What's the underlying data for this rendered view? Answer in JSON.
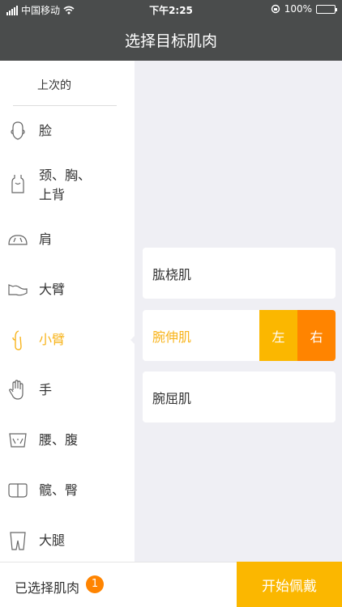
{
  "status_bar": {
    "carrier": "中国移动",
    "time": "下午2:25",
    "battery": "100%",
    "battery_level": 1.0
  },
  "header": {
    "title": "选择目标肌肉"
  },
  "sidebar": {
    "recent_label": "上次的",
    "items": [
      {
        "label": "脸",
        "icon": "face-icon"
      },
      {
        "label": "颈、胸、\n上背",
        "icon": "torso-icon"
      },
      {
        "label": "肩",
        "icon": "shoulder-icon"
      },
      {
        "label": "大臂",
        "icon": "upper-arm-icon"
      },
      {
        "label": "小臂",
        "icon": "forearm-icon",
        "active": true
      },
      {
        "label": "手",
        "icon": "hand-icon"
      },
      {
        "label": "腰、腹",
        "icon": "waist-icon"
      },
      {
        "label": "髋、臀",
        "icon": "hip-icon"
      },
      {
        "label": "大腿",
        "icon": "thigh-icon"
      }
    ]
  },
  "muscles": [
    {
      "label": "肱桡肌"
    },
    {
      "label": "腕伸肌",
      "active": true,
      "left_label": "左",
      "right_label": "右"
    },
    {
      "label": "腕屈肌"
    }
  ],
  "bottom": {
    "selected_label": "已选择肌肉",
    "count": "1",
    "start_label": "开始佩戴"
  },
  "colors": {
    "header_bg": "#4a4c4c",
    "accent_yellow": "#fbb700",
    "accent_orange": "#ff8400",
    "content_bg": "#efeff4"
  }
}
